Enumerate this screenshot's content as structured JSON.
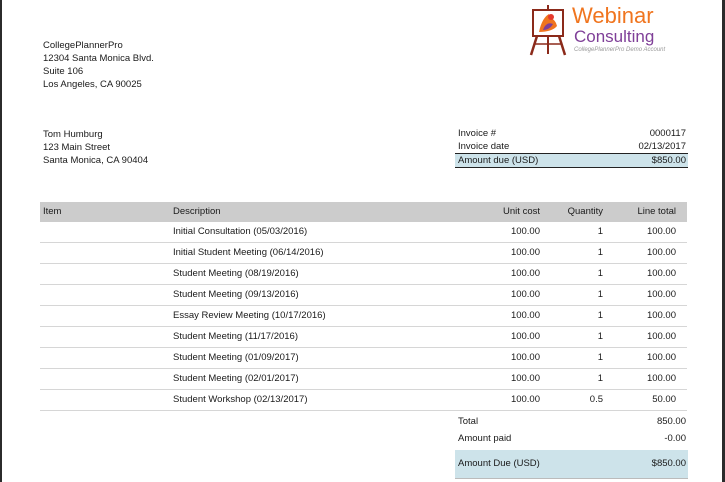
{
  "logo": {
    "line1": "Webinar",
    "line2": "Consulting",
    "tagline": "CollegePlannerPro Demo Account"
  },
  "company": {
    "name": "CollegePlannerPro",
    "street": "12304 Santa Monica Blvd.",
    "suite": "Suite 106",
    "city": "Los Angeles, CA 90025"
  },
  "client": {
    "name": "Tom Humburg",
    "street": "123 Main Street",
    "city": "Santa Monica, CA 90404"
  },
  "invoice": {
    "number_label": "Invoice #",
    "number": "0000117",
    "date_label": "Invoice date",
    "date": "02/13/2017",
    "due_label": "Amount due (USD)",
    "due": "$850.00"
  },
  "table": {
    "headers": {
      "item": "Item",
      "description": "Description",
      "unit_cost": "Unit cost",
      "quantity": "Quantity",
      "line_total": "Line total"
    },
    "rows": [
      {
        "item": "",
        "description": "Initial Consultation (05/03/2016)",
        "unit_cost": "100.00",
        "quantity": "1",
        "line_total": "100.00"
      },
      {
        "item": "",
        "description": "Initial Student Meeting (06/14/2016)",
        "unit_cost": "100.00",
        "quantity": "1",
        "line_total": "100.00"
      },
      {
        "item": "",
        "description": "Student Meeting (08/19/2016)",
        "unit_cost": "100.00",
        "quantity": "1",
        "line_total": "100.00"
      },
      {
        "item": "",
        "description": "Student Meeting (09/13/2016)",
        "unit_cost": "100.00",
        "quantity": "1",
        "line_total": "100.00"
      },
      {
        "item": "",
        "description": "Essay Review Meeting (10/17/2016)",
        "unit_cost": "100.00",
        "quantity": "1",
        "line_total": "100.00"
      },
      {
        "item": "",
        "description": "Student Meeting (11/17/2016)",
        "unit_cost": "100.00",
        "quantity": "1",
        "line_total": "100.00"
      },
      {
        "item": "",
        "description": "Student Meeting (01/09/2017)",
        "unit_cost": "100.00",
        "quantity": "1",
        "line_total": "100.00"
      },
      {
        "item": "",
        "description": "Student Meeting (02/01/2017)",
        "unit_cost": "100.00",
        "quantity": "1",
        "line_total": "100.00"
      },
      {
        "item": "",
        "description": "Student Workshop (02/13/2017)",
        "unit_cost": "100.00",
        "quantity": "0.5",
        "line_total": "50.00"
      }
    ]
  },
  "totals": {
    "total_label": "Total",
    "total": "850.00",
    "paid_label": "Amount paid",
    "paid": "-0.00",
    "due_label": "Amount Due (USD)",
    "due": "$850.00"
  },
  "colors": {
    "header_gray": "#cccccc",
    "due_highlight": "#cde3ea",
    "logo_orange": "#f0751f",
    "logo_purple": "#7f3f98"
  }
}
